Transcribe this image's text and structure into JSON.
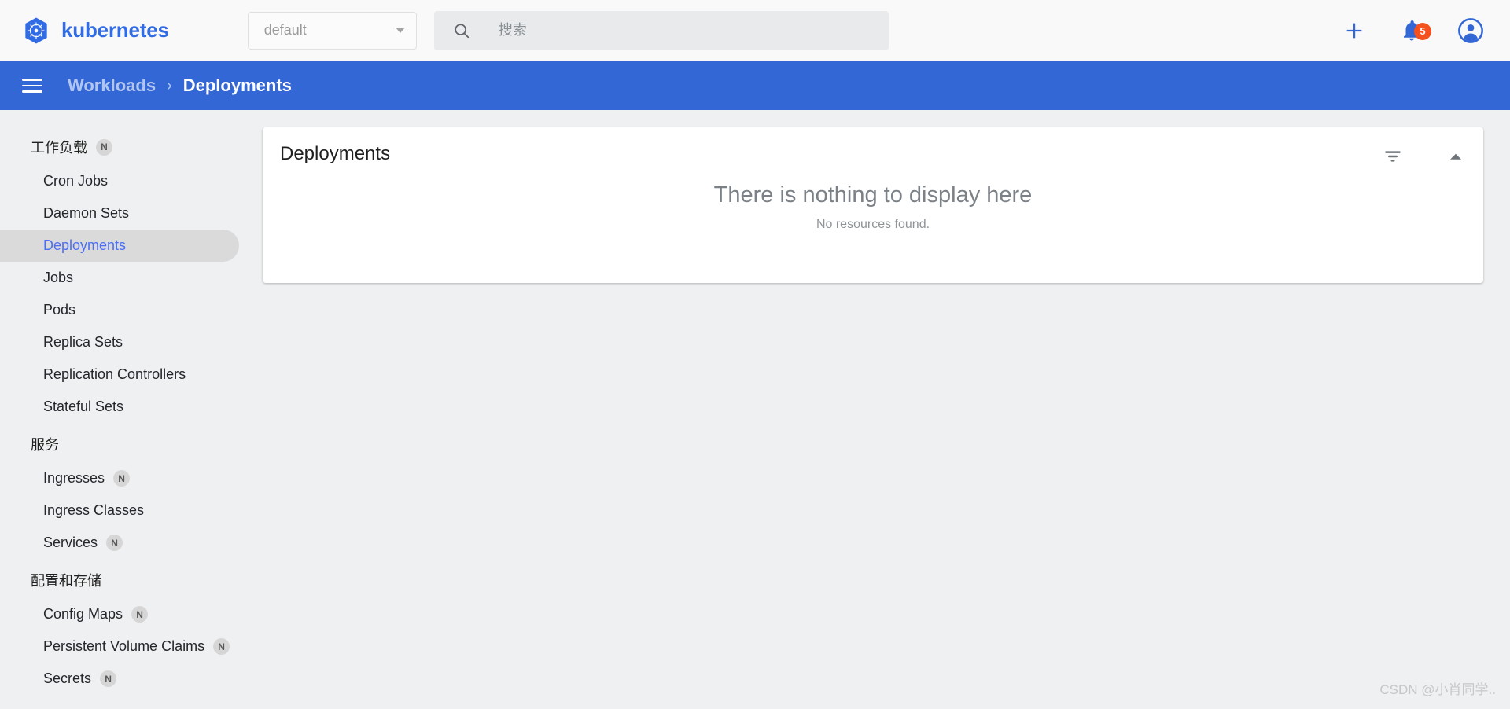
{
  "topbar": {
    "brand": "kubernetes",
    "logo_icon": "kubernetes-helm-icon",
    "namespace": {
      "value": "default",
      "caret_icon": "chevron-down-icon"
    },
    "search": {
      "placeholder": "搜索",
      "value": "",
      "icon": "search-icon"
    },
    "actions": {
      "create_icon": "plus-icon",
      "notifications_icon": "bell-icon",
      "notifications_count": "5",
      "account_icon": "account-circle-icon"
    }
  },
  "breadcrumb": {
    "menu_icon": "hamburger-menu-icon",
    "parent": "Workloads",
    "separator": "›",
    "current": "Deployments"
  },
  "sidebar": {
    "groups": [
      {
        "title": "工作负载",
        "badge": "N",
        "items": [
          {
            "label": "Cron Jobs",
            "badge": "",
            "active": false
          },
          {
            "label": "Daemon Sets",
            "badge": "",
            "active": false
          },
          {
            "label": "Deployments",
            "badge": "",
            "active": true
          },
          {
            "label": "Jobs",
            "badge": "",
            "active": false
          },
          {
            "label": "Pods",
            "badge": "",
            "active": false
          },
          {
            "label": "Replica Sets",
            "badge": "",
            "active": false
          },
          {
            "label": "Replication Controllers",
            "badge": "",
            "active": false
          },
          {
            "label": "Stateful Sets",
            "badge": "",
            "active": false
          }
        ]
      },
      {
        "title": "服务",
        "badge": "",
        "items": [
          {
            "label": "Ingresses",
            "badge": "N",
            "active": false
          },
          {
            "label": "Ingress Classes",
            "badge": "",
            "active": false
          },
          {
            "label": "Services",
            "badge": "N",
            "active": false
          }
        ]
      },
      {
        "title": "配置和存储",
        "badge": "",
        "items": [
          {
            "label": "Config Maps",
            "badge": "N",
            "active": false
          },
          {
            "label": "Persistent Volume Claims",
            "badge": "N",
            "active": false
          },
          {
            "label": "Secrets",
            "badge": "N",
            "active": false
          }
        ]
      }
    ]
  },
  "card": {
    "title": "Deployments",
    "filter_icon": "filter-list-icon",
    "collapse_icon": "chevron-up-icon",
    "empty_title": "There is nothing to display here",
    "empty_subtitle": "No resources found."
  },
  "watermark": {
    "text": "CSDN @小肖同学.."
  },
  "colors": {
    "brand_blue": "#326ce5",
    "breadcrumb_blue": "#3367d6",
    "active_item_text": "#4b6ef5",
    "active_item_bg": "#dadada",
    "badge_red": "#f4511e",
    "page_bg": "#eff0f1",
    "topbar_bg": "#f9f9f9",
    "search_bg": "#e8eaec"
  }
}
